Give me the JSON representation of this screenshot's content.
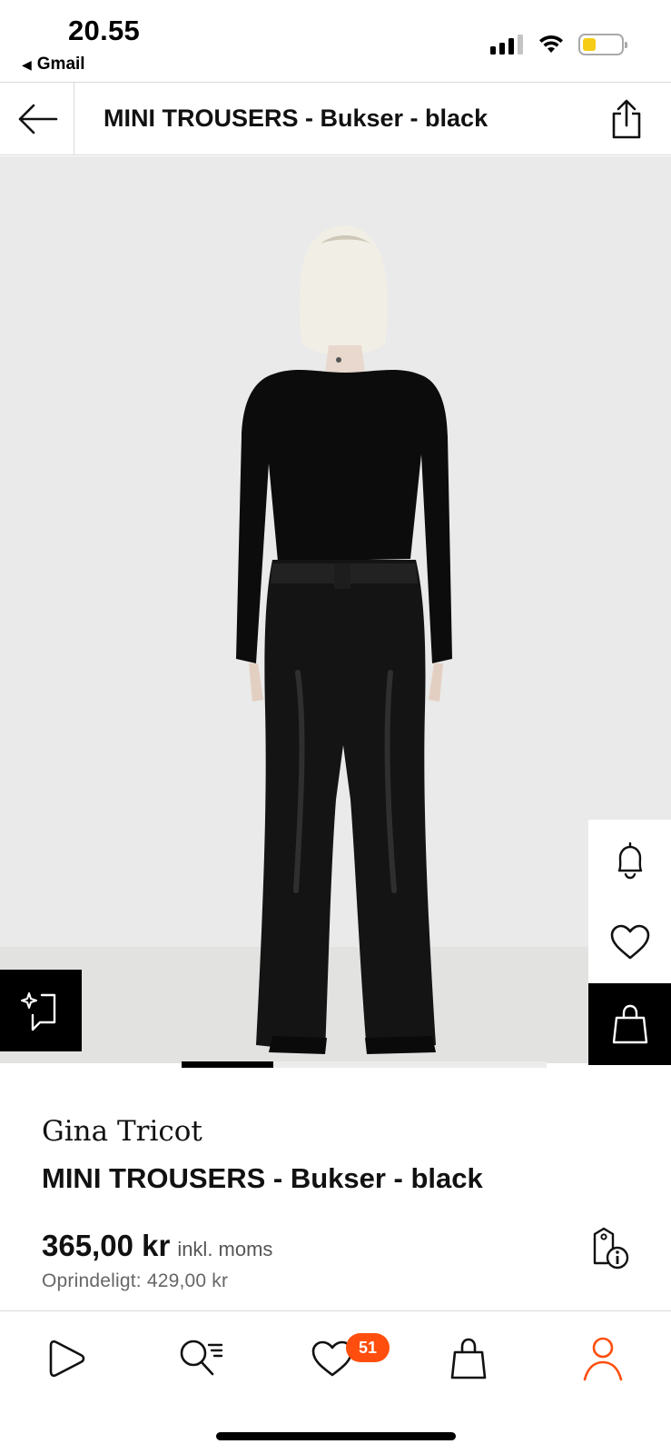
{
  "status_bar": {
    "time": "20.55",
    "back_app": "Gmail",
    "back_glyph": "◀"
  },
  "header": {
    "title": "MINI TROUSERS - Bukser - black"
  },
  "gallery": {
    "slide_index": 1,
    "slide_count": 4
  },
  "product": {
    "brand": "Gina Tricot",
    "name": "MINI TROUSERS - Bukser - black",
    "price": "365,00 kr",
    "price_note": "inkl. moms",
    "original_price": "Oprindeligt: 429,00 kr"
  },
  "bottom_nav": {
    "wishlist_count": "51",
    "items": [
      "discover",
      "search",
      "wishlist",
      "bag",
      "profile"
    ],
    "active": "profile"
  },
  "colors": {
    "accent": "#ff4e0d",
    "battery": "#f6cc16",
    "image_background": "#e9eae9"
  },
  "icons": [
    "back-arrow-icon",
    "share-icon",
    "try-on-icon",
    "bell-icon",
    "heart-icon",
    "bag-icon",
    "price-info-icon",
    "play-icon",
    "search-icon",
    "profile-icon"
  ]
}
